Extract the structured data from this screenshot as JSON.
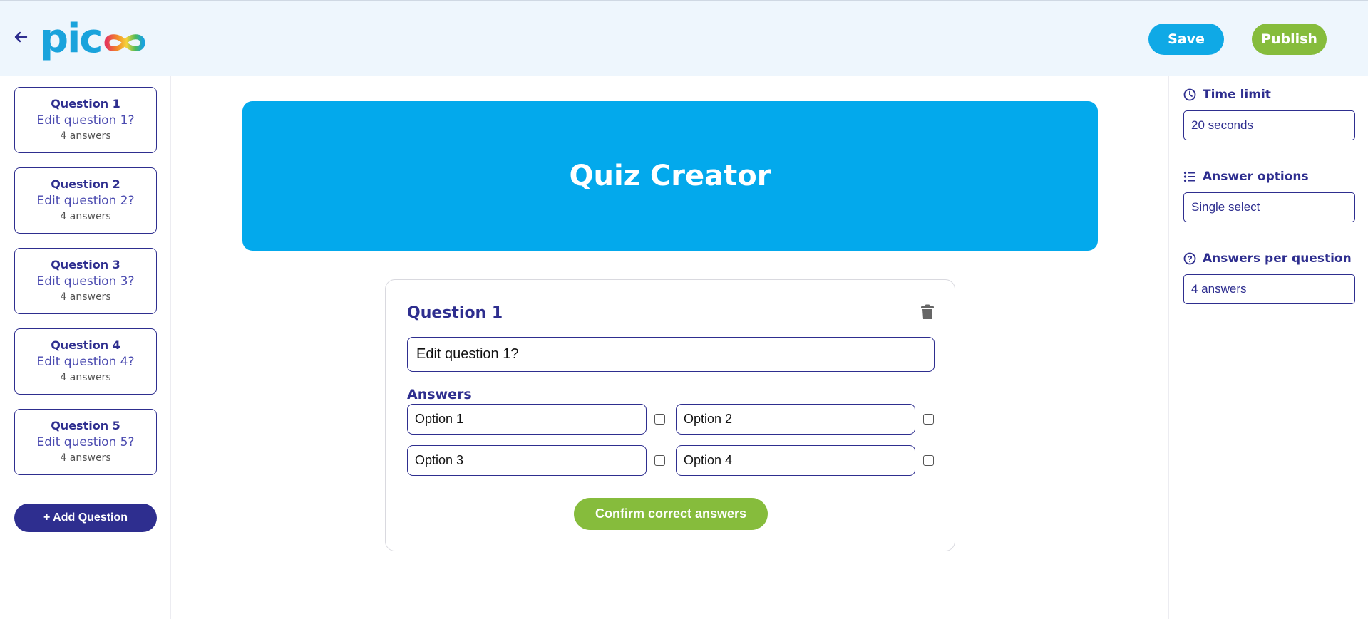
{
  "header": {
    "logo_text": "pic",
    "save_label": "Save",
    "publish_label": "Publish"
  },
  "sidebar": {
    "questions": [
      {
        "title": "Question 1",
        "text": "Edit question 1?",
        "count": "4 answers"
      },
      {
        "title": "Question 2",
        "text": "Edit question 2?",
        "count": "4 answers"
      },
      {
        "title": "Question 3",
        "text": "Edit question 3?",
        "count": "4 answers"
      },
      {
        "title": "Question 4",
        "text": "Edit question 4?",
        "count": "4 answers"
      },
      {
        "title": "Question 5",
        "text": "Edit question 5?",
        "count": "4 answers"
      }
    ],
    "add_label": "+ Add Question"
  },
  "main": {
    "hero_title": "Quiz Creator",
    "editor": {
      "title": "Question 1",
      "question_value": "Edit question 1?",
      "answers_label": "Answers",
      "options": [
        "Option 1",
        "Option 2",
        "Option 3",
        "Option 4"
      ],
      "confirm_label": "Confirm correct answers"
    }
  },
  "settings": {
    "time_limit_label": "Time limit",
    "time_limit_value": "20 seconds",
    "answer_options_label": "Answer options",
    "answer_options_value": "Single select",
    "answers_per_question_label": "Answers per question",
    "answers_per_question_value": "4 answers"
  },
  "colors": {
    "primary": "#2e2e8f",
    "accent_blue": "#03a9ec",
    "accent_green": "#86bc3c",
    "topbar_bg": "#eef6fd"
  }
}
